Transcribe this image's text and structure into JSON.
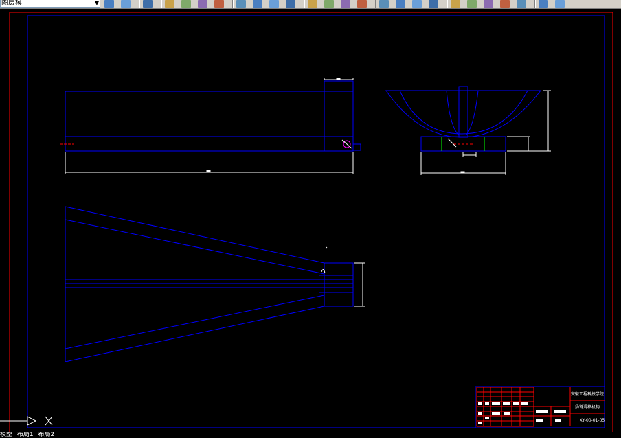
{
  "toolbar": {
    "layer_combo_value": "图层模",
    "buttons": [
      "layer-manager",
      "layer-previous",
      "open",
      "save",
      "plot",
      "preview",
      "publish",
      "cut",
      "copy",
      "paste",
      "match-properties",
      "block",
      "undo",
      "redo",
      "pan",
      "zoom-realtime",
      "zoom-window",
      "zoom-previous",
      "properties",
      "design-center",
      "tool-palettes",
      "sheet-set",
      "markup",
      "quickcalc",
      "help",
      "layers"
    ]
  },
  "layout_tabs": [
    "模型",
    "布局1",
    "布局2"
  ],
  "title_block": {
    "school": "安徽工程科技学院",
    "drawing_name": "扬臂滑移机构",
    "drawing_number": "XY-00-01-05"
  },
  "colors": {
    "background": "#000000",
    "frame_outer": "#ff0000",
    "frame_inner": "#0000ff",
    "geometry": "#0000ff",
    "dimension": "#ffffff",
    "center_line": "#ff0000",
    "section_line": "#00ff00"
  },
  "ucs_icon": {
    "axis_label": "X"
  }
}
